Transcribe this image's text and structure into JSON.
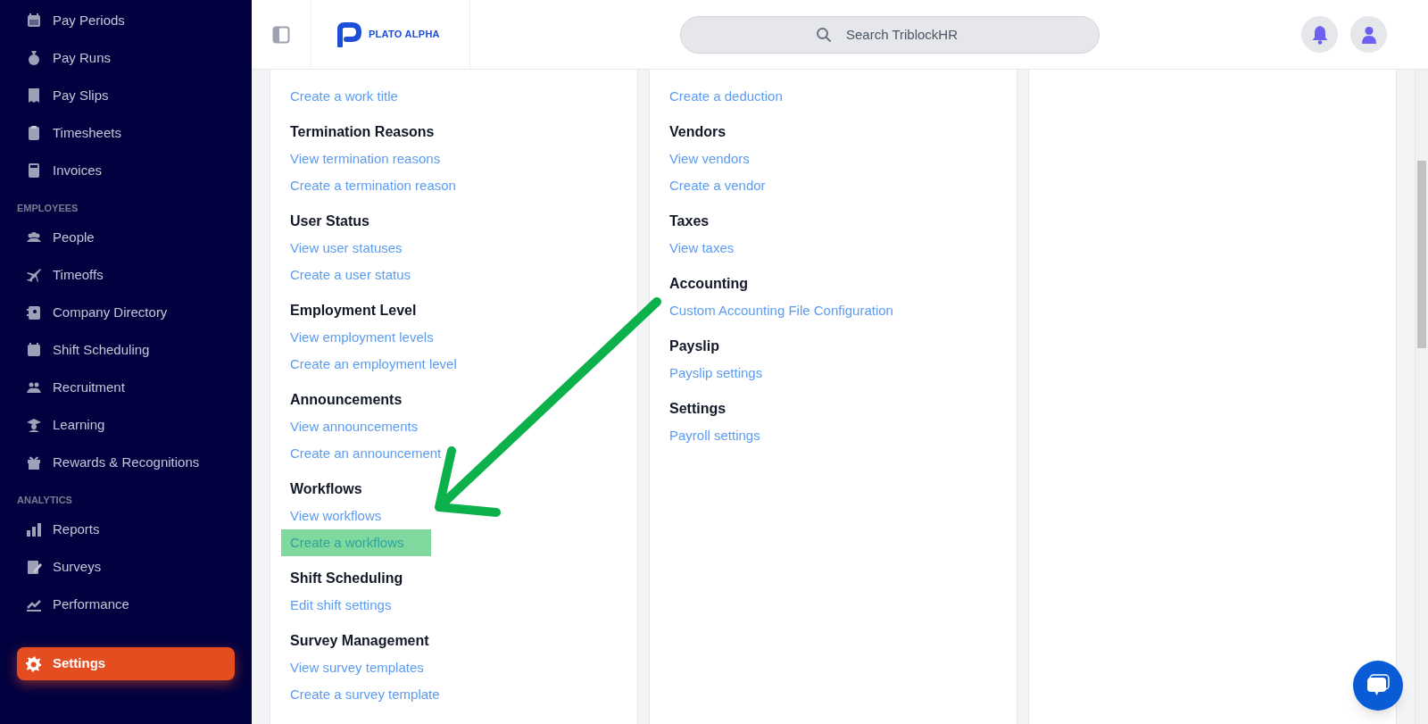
{
  "sidebar": {
    "sections": [
      {
        "items": [
          {
            "label": "Pay Periods",
            "selected": false
          },
          {
            "label": "Pay Runs",
            "selected": false
          },
          {
            "label": "Pay Slips",
            "selected": false
          },
          {
            "label": "Timesheets",
            "selected": false
          },
          {
            "label": "Invoices",
            "selected": false
          }
        ]
      },
      {
        "heading": "EMPLOYEES",
        "items": [
          {
            "label": "People",
            "selected": false
          },
          {
            "label": "Timeoffs",
            "selected": false
          },
          {
            "label": "Company Directory",
            "selected": false
          },
          {
            "label": "Shift Scheduling",
            "selected": false
          },
          {
            "label": "Recruitment",
            "selected": false
          },
          {
            "label": "Learning",
            "selected": false
          },
          {
            "label": "Rewards & Recognitions",
            "selected": false
          }
        ]
      },
      {
        "heading": "ANALYTICS",
        "items": [
          {
            "label": "Reports",
            "selected": false
          },
          {
            "label": "Surveys",
            "selected": false
          },
          {
            "label": "Performance",
            "selected": false
          }
        ]
      },
      {
        "items": [
          {
            "label": "Settings",
            "selected": true
          }
        ]
      }
    ]
  },
  "header": {
    "logo": "PLATO ALPHA",
    "search": {
      "placeholder": "Search TriblockHR"
    }
  },
  "columns": [
    {
      "sections": [
        {
          "links": [
            {
              "label": "Create a work title",
              "highlighted": false
            }
          ]
        },
        {
          "title": "Termination Reasons",
          "links": [
            {
              "label": "View termination reasons",
              "highlighted": false
            },
            {
              "label": "Create a termination reason",
              "highlighted": false
            }
          ]
        },
        {
          "title": "User Status",
          "links": [
            {
              "label": "View user statuses",
              "highlighted": false
            },
            {
              "label": "Create a user status",
              "highlighted": false
            }
          ]
        },
        {
          "title": "Employment Level",
          "links": [
            {
              "label": "View employment levels",
              "highlighted": false
            },
            {
              "label": "Create an employment level",
              "highlighted": false
            }
          ]
        },
        {
          "title": "Announcements",
          "links": [
            {
              "label": "View announcements",
              "highlighted": false
            },
            {
              "label": "Create an announcement",
              "highlighted": false
            }
          ]
        },
        {
          "title": "Workflows",
          "links": [
            {
              "label": "View workflows",
              "highlighted": false
            },
            {
              "label": "Create a workflows",
              "highlighted": true
            }
          ]
        },
        {
          "title": "Shift Scheduling",
          "links": [
            {
              "label": "Edit shift settings",
              "highlighted": false
            }
          ]
        },
        {
          "title": "Survey Management",
          "links": [
            {
              "label": "View survey templates",
              "highlighted": false
            },
            {
              "label": "Create a survey template",
              "highlighted": false
            }
          ]
        }
      ]
    },
    {
      "sections": [
        {
          "links": [
            {
              "label": "Create a deduction",
              "highlighted": false
            }
          ]
        },
        {
          "title": "Vendors",
          "links": [
            {
              "label": "View vendors",
              "highlighted": false
            },
            {
              "label": "Create a vendor",
              "highlighted": false
            }
          ]
        },
        {
          "title": "Taxes",
          "links": [
            {
              "label": "View taxes",
              "highlighted": false
            }
          ]
        },
        {
          "title": "Accounting",
          "links": [
            {
              "label": "Custom Accounting File Configuration",
              "highlighted": false
            }
          ]
        },
        {
          "title": "Payslip",
          "links": [
            {
              "label": "Payslip settings",
              "highlighted": false
            }
          ]
        },
        {
          "title": "Settings",
          "links": [
            {
              "label": "Payroll settings",
              "highlighted": false
            }
          ]
        }
      ]
    }
  ]
}
